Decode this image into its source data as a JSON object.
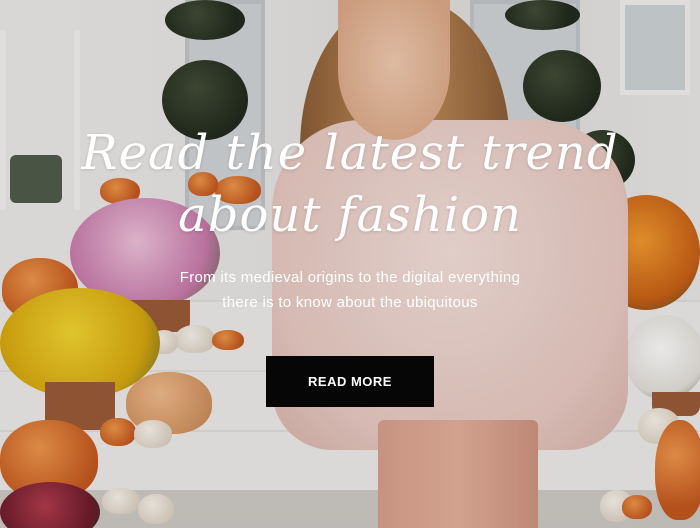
{
  "hero": {
    "heading_line1": "Read the latest trend",
    "heading_line2": "about fashion",
    "subtext_line1": "From its medieval origins to the digital everything",
    "subtext_line2": "there is to know about the ubiquitous",
    "cta_label": "READ MORE"
  },
  "colors": {
    "cta_background": "#060606",
    "text": "#ffffff"
  }
}
